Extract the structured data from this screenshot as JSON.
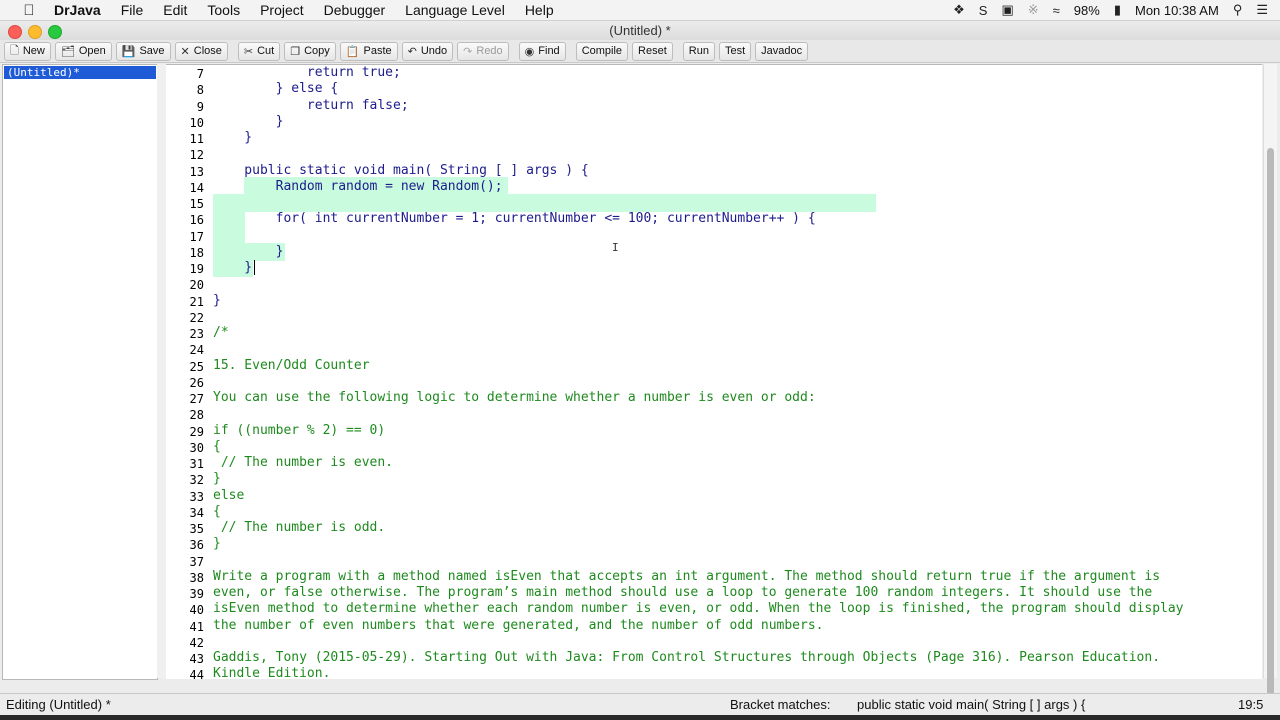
{
  "menubar": {
    "app_name": "DrJava",
    "items": [
      "File",
      "Edit",
      "Tools",
      "Project",
      "Debugger",
      "Language Level",
      "Help"
    ],
    "battery": "98%",
    "clock": "Mon 10:38 AM"
  },
  "window": {
    "title": "(Untitled) *"
  },
  "toolbar": {
    "new": "New",
    "open": "Open",
    "save": "Save",
    "close": "Close",
    "cut": "Cut",
    "copy": "Copy",
    "paste": "Paste",
    "undo": "Undo",
    "redo": "Redo",
    "find": "Find",
    "compile": "Compile",
    "reset": "Reset",
    "run": "Run",
    "test": "Test",
    "javadoc": "Javadoc"
  },
  "documents": {
    "items": [
      "(Untitled)*"
    ]
  },
  "editor": {
    "lines": [
      {
        "n": "7",
        "text": "            return true;"
      },
      {
        "n": "8",
        "text": "        } else {"
      },
      {
        "n": "9",
        "text": "            return false;"
      },
      {
        "n": "10",
        "text": "        }"
      },
      {
        "n": "11",
        "text": "    }"
      },
      {
        "n": "12",
        "text": ""
      },
      {
        "n": "13",
        "text": "    public static void main( String [ ] args ) {"
      },
      {
        "n": "14",
        "text": "        Random random = new Random();"
      },
      {
        "n": "15",
        "text": ""
      },
      {
        "n": "16",
        "text": "        for( int currentNumber = 1; currentNumber <= 100; currentNumber++ ) {"
      },
      {
        "n": "17",
        "text": ""
      },
      {
        "n": "18",
        "text": "        }"
      },
      {
        "n": "19",
        "text": "    }"
      },
      {
        "n": "20",
        "text": ""
      },
      {
        "n": "21",
        "text": "}"
      },
      {
        "n": "22",
        "text": ""
      },
      {
        "n": "23",
        "text": "/*"
      },
      {
        "n": "24",
        "text": ""
      },
      {
        "n": "25",
        "text": "15. Even/Odd Counter"
      },
      {
        "n": "26",
        "text": ""
      },
      {
        "n": "27",
        "text": "You can use the following logic to determine whether a number is even or odd:"
      },
      {
        "n": "28",
        "text": ""
      },
      {
        "n": "29",
        "text": "if ((number % 2) == 0)"
      },
      {
        "n": "30",
        "text": "{"
      },
      {
        "n": "31",
        "text": " // The number is even."
      },
      {
        "n": "32",
        "text": "}"
      },
      {
        "n": "33",
        "text": "else"
      },
      {
        "n": "34",
        "text": "{"
      },
      {
        "n": "35",
        "text": " // The number is odd."
      },
      {
        "n": "36",
        "text": "}"
      },
      {
        "n": "37",
        "text": ""
      },
      {
        "n": "38",
        "text": "Write a program with a method named isEven that accepts an int argument. The method should return true if the argument is"
      },
      {
        "n": "39",
        "text": "even, or false otherwise. The program’s main method should use a loop to generate 100 random integers. It should use the"
      },
      {
        "n": "40",
        "text": "isEven method to determine whether each random number is even, or odd. When the loop is finished, the program should display"
      },
      {
        "n": "41",
        "text": "the number of even numbers that were generated, and the number of odd numbers."
      },
      {
        "n": "42",
        "text": ""
      },
      {
        "n": "43",
        "text": "Gaddis, Tony (2015-05-29). Starting Out with Java: From Control Structures through Objects (Page 316). Pearson Education."
      },
      {
        "n": "44",
        "text": "Kindle Edition."
      }
    ]
  },
  "status": {
    "editing": "Editing (Untitled) *",
    "bracket_label": "Bracket matches:",
    "bracket_text": "public static void main( String [ ] args ) {",
    "position": "19:5"
  }
}
